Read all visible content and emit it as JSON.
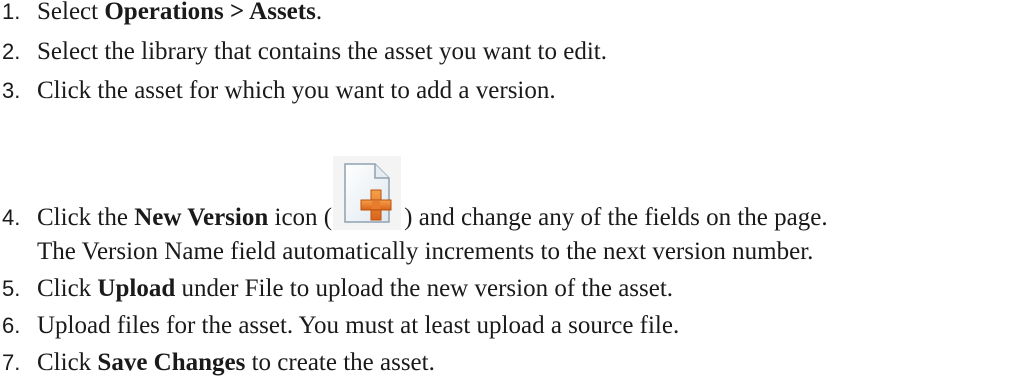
{
  "steps": [
    {
      "number": "1.",
      "prefix": "Select ",
      "bold": "Operations > Assets",
      "suffix": "."
    },
    {
      "number": "2.",
      "text": "Select the library that contains the asset you want to edit."
    },
    {
      "number": "3.",
      "text": "Click the asset for which you want to add a version."
    },
    {
      "number": "4.",
      "prefix": "Click the ",
      "bold": "New Version",
      "middle": " icon (",
      "icon": "new-version-icon",
      "suffix": ") and change any of the fields on the page.",
      "continuation": "The Version Name field automatically increments to the next version number."
    },
    {
      "number": "5.",
      "prefix": "Click ",
      "bold": "Upload",
      "suffix": " under File to upload the new version of the asset."
    },
    {
      "number": "6.",
      "text": "Upload files for the asset. You must at least upload a source file."
    },
    {
      "number": "7.",
      "prefix": "Click ",
      "bold": "Save Changes",
      "suffix": " to create the asset."
    }
  ],
  "colors": {
    "text": "#1a1a1a",
    "icon_plus": "#e8792a",
    "icon_page": "#eef4f8"
  }
}
